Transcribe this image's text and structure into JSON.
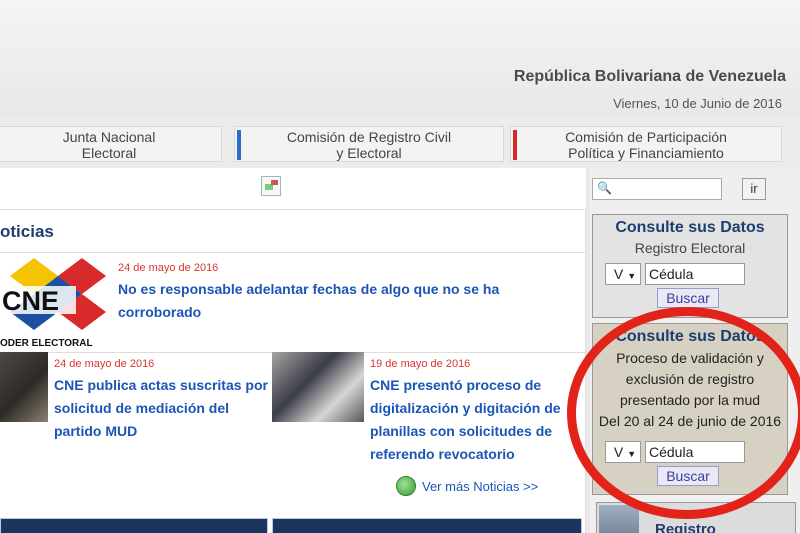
{
  "header": {
    "country": "República Bolivariana de Venezuela",
    "date": "Viernes, 10 de Junio de 2016"
  },
  "nav": {
    "tabs": [
      {
        "line1": "Junta Nacional",
        "line2": "Electoral",
        "accent": ""
      },
      {
        "line1": "Comisión de Registro Civil",
        "line2": "y Electoral",
        "accent": "#2a6ec8"
      },
      {
        "line1": "Comisión de Participación",
        "line2": "Política y Financiamiento",
        "accent": "#d42a2a"
      }
    ]
  },
  "main": {
    "section_title": "oticias",
    "logo_text": "CNE",
    "logo_subtext": "ODER ELECTORAL",
    "featured": {
      "date": "24 de mayo de 2016",
      "title_line1": "No es responsable adelantar fechas de algo que no se ha",
      "title_line2": "corroborado"
    },
    "news": [
      {
        "date": "24 de mayo de 2016",
        "lines": [
          "CNE publica actas suscritas por",
          "solicitud de mediación del",
          "partido MUD"
        ]
      },
      {
        "date": "19 de mayo de 2016",
        "lines": [
          "CNE presentó proceso de",
          "digitalización y digitación de",
          "planillas con solicitudes de",
          "referendo revocatorio"
        ]
      }
    ],
    "more_link": "Ver más Noticias >>"
  },
  "sidebar": {
    "search_button": "ir",
    "panel1": {
      "title": "Consulte sus Datos",
      "subtitle": "Registro Electoral",
      "select_value": "V",
      "id_value": "Cédula",
      "button": "Buscar"
    },
    "panel2": {
      "title": "Consulte sus Datos",
      "lines": [
        "Proceso de validación y",
        "exclusión de registro",
        "presentado por la mud",
        "Del 20 al 24 de junio de 2016"
      ],
      "select_value": "V",
      "id_value": "Cédula",
      "button": "Buscar"
    },
    "registro_label": "Registro"
  },
  "colors": {
    "link_blue": "#1b55b5",
    "title_navy": "#1f3d6e",
    "date_red": "#d33",
    "highlight_circle": "#e2231a"
  }
}
